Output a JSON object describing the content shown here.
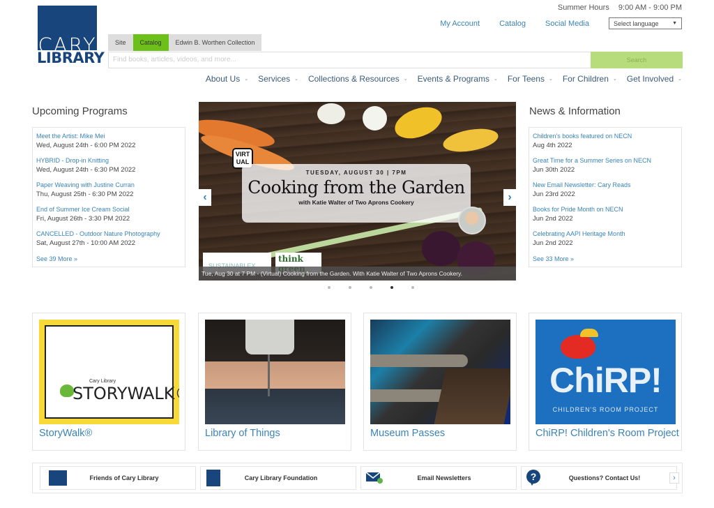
{
  "header": {
    "logo_top": "CARY",
    "logo_bottom": "LIBRARY",
    "hours_label": "Summer Hours",
    "hours_value": "9:00 AM - 9:00 PM",
    "top_links": [
      "My Account",
      "Catalog",
      "Social Media"
    ],
    "language_select": "Select language"
  },
  "search": {
    "tabs": [
      {
        "label": "Site",
        "active": false
      },
      {
        "label": "Catalog",
        "active": true
      },
      {
        "label": "Edwin B. Worthen Collection",
        "active": false
      }
    ],
    "placeholder": "Find books, articles, videos, and more...",
    "button": "Search"
  },
  "nav": [
    "About Us",
    "Services",
    "Collections & Resources",
    "Events & Programs",
    "For Teens",
    "For Children",
    "Get Involved"
  ],
  "programs": {
    "title": "Upcoming Programs",
    "items": [
      {
        "title": "Meet the Artist: Mike Mei",
        "date": "Wed, August 24th - 6:00 PM 2022"
      },
      {
        "title": "HYBRID - Drop-in Knitting",
        "date": "Wed, August 24th - 6:30 PM 2022"
      },
      {
        "title": "Paper Weaving with Justine Curran",
        "date": "Thu, August 25th - 6:30 PM 2022"
      },
      {
        "title": "End of Summer Ice Cream Social",
        "date": "Fri, August 26th - 3:30 PM 2022"
      },
      {
        "title": "CANCELLED - Outdoor Nature Photography",
        "date": "Sat, August 27th - 10:00 AM 2022"
      }
    ],
    "more": "See 39 More »"
  },
  "news": {
    "title": "News & Information",
    "items": [
      {
        "title": "Children's books featured on NECN",
        "date": "Aug 4th 2022"
      },
      {
        "title": "Great Time for a Summer Series on NECN",
        "date": "Jun 30th 2022"
      },
      {
        "title": "New Email Newsletter: Cary Reads",
        "date": "Jun 23rd 2022"
      },
      {
        "title": "Books for Pride Month on NECN",
        "date": "Jun 2nd 2022"
      },
      {
        "title": "Celebrating AAPI Heritage Month",
        "date": "Jun 2nd 2022"
      }
    ],
    "more": "See 33 More »"
  },
  "slideshow": {
    "badge": "VIRT UAL",
    "date_line": "TUESDAY, AUGUST 30 | 7PM",
    "title": "Cooking from the Garden",
    "subtitle": "with Katie Walter of Two Aprons Cookery",
    "sponsor1": "SUSTAINABLEX",
    "sponsor2": "think green",
    "caption": "Tue, Aug 30 at 7 PM - (Virtual) Cooking from the Garden. With Katie Walter of Two Aprons Cookery.",
    "prev_icon": "‹",
    "next_icon": "›",
    "slide_count": 5,
    "active_slide": 4
  },
  "cards": [
    {
      "title": "StoryWalk®",
      "image_small": "Cary Library",
      "image_big": "STORYWALK®"
    },
    {
      "title": "Library of Things"
    },
    {
      "title": "Museum Passes"
    },
    {
      "title": "ChiRP! Children's Room Project",
      "image_big": "ChiRP!",
      "image_small": "CHILDREN'S ROOM PROJECT"
    }
  ],
  "quick_links": [
    {
      "label": "Friends of Cary Library",
      "icon": "friends-logo-icon"
    },
    {
      "label": "Cary Library Foundation",
      "icon": "foundation-logo-icon"
    },
    {
      "label": "Email Newsletters",
      "icon": "mail-icon"
    },
    {
      "label": "Questions? Contact Us!",
      "icon": "question-icon"
    }
  ],
  "quick_next": "›"
}
